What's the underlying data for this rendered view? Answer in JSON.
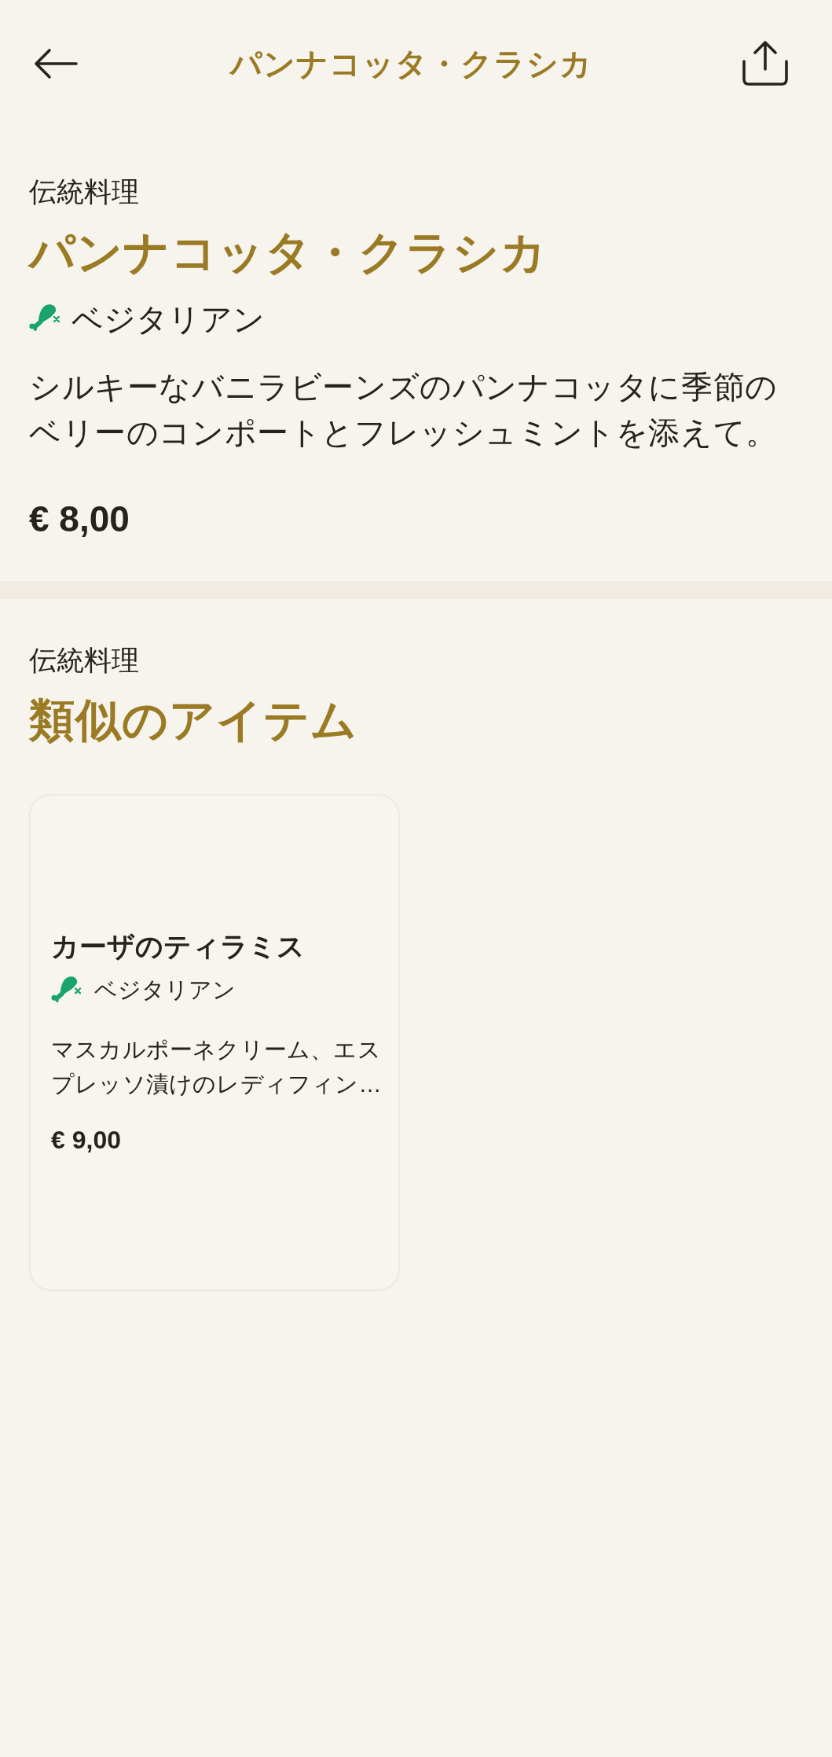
{
  "header": {
    "title": "パンナコッタ・クラシカ"
  },
  "item": {
    "category": "伝統料理",
    "name": "パンナコッタ・クラシカ",
    "tags": [
      {
        "kind": "vegetarian",
        "label": "ベジタリアン"
      }
    ],
    "description": "シルキーなバニラビーンズのパンナコッタに季節のベリーのコンポートとフレッシュミントを添えて。",
    "price": "€ 8,00"
  },
  "similar": {
    "category": "伝統料理",
    "title": "類似のアイテム",
    "items": [
      {
        "name": "カーザのティラミス",
        "tags": [
          {
            "kind": "vegetarian",
            "label": "ベジタリアン"
          }
        ],
        "description": "マスカルポーネクリーム、エスプレッソ漬けのレディフィン…",
        "price": "€ 9,00"
      }
    ]
  }
}
